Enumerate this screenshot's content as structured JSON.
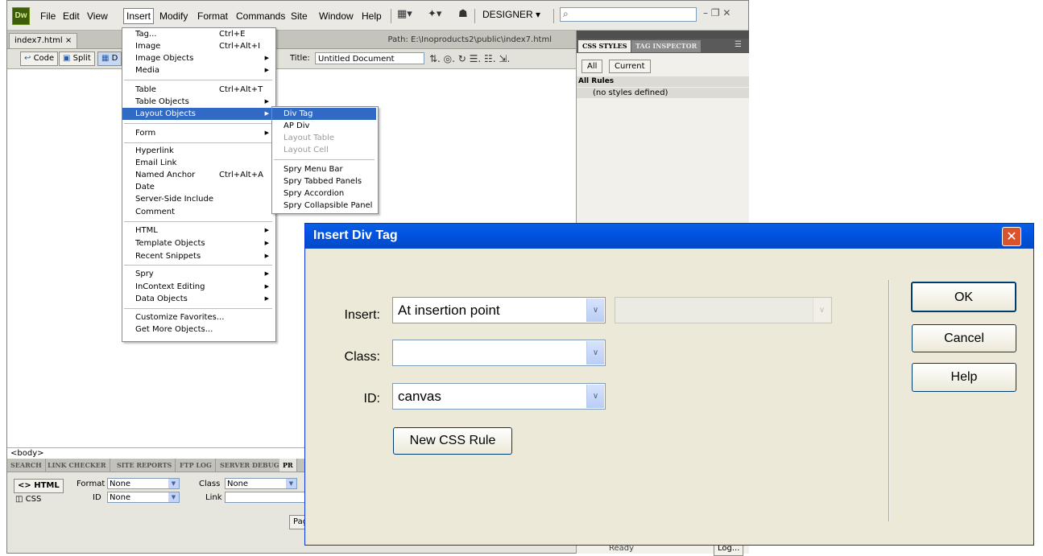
{
  "menubar": {
    "logo": "Dw",
    "items": [
      "File",
      "Edit",
      "View",
      "Insert",
      "Modify",
      "Format",
      "Commands",
      "Site",
      "Window",
      "Help"
    ],
    "workspace": "DESIGNER ▾",
    "layout_glyph": "▦▾",
    "extend_glyph": "✦▾",
    "site_glyph": "☗",
    "search_icon": "⌕",
    "window_controls": "–  ❐  ✕"
  },
  "document": {
    "tab_label": "index7.html  ×",
    "path": "Path:  E:\\Inoproducts2\\public\\index7.html",
    "toolbar": {
      "code": "Code",
      "split": "Split",
      "design_partial": "D",
      "title_label": "Title:",
      "title_value": "Untitled Document",
      "glyphs": "⇅.  ◎.    ↻  ☰.  ☷.     ⇲."
    },
    "tag_selector": "<body>"
  },
  "panels": {
    "tabs": [
      "SEARCH",
      "LINK CHECKER",
      "SITE REPORTS",
      "FTP LOG",
      "SERVER DEBUG",
      "PR"
    ],
    "html_button": "<> HTML",
    "css_button": "CSS",
    "format_label": "Format",
    "format_value": "None",
    "class_label": "Class",
    "class_value": "None",
    "id_label": "ID",
    "id_value": "None",
    "link_label": "Link",
    "page_btn_partial": "Pag"
  },
  "css_panel": {
    "tab1": "CSS STYLES",
    "tab2": "TAG INSPECTOR",
    "btn_all": "All",
    "btn_current": "Current",
    "all_rules": "All Rules",
    "no_styles": "(no styles defined)",
    "ready_partial": "Ready",
    "log_partial": "Log..."
  },
  "insert_menu": {
    "items": [
      {
        "label": "Tag...",
        "shortcut": "Ctrl+E"
      },
      {
        "label": "Image",
        "shortcut": "Ctrl+Alt+I"
      },
      {
        "label": "Image Objects",
        "submenu": true
      },
      {
        "label": "Media",
        "submenu": true
      },
      {
        "label": "Table",
        "shortcut": "Ctrl+Alt+T"
      },
      {
        "label": "Table Objects",
        "submenu": true
      },
      {
        "label": "Layout Objects",
        "submenu": true,
        "highlighted": true
      },
      {
        "label": "Form",
        "submenu": true
      },
      {
        "label": "Hyperlink"
      },
      {
        "label": "Email Link"
      },
      {
        "label": "Named Anchor",
        "shortcut": "Ctrl+Alt+A"
      },
      {
        "label": "Date"
      },
      {
        "label": "Server-Side Include"
      },
      {
        "label": "Comment"
      },
      {
        "label": "HTML",
        "submenu": true
      },
      {
        "label": "Template Objects",
        "submenu": true
      },
      {
        "label": "Recent Snippets",
        "submenu": true
      },
      {
        "label": "Spry",
        "submenu": true
      },
      {
        "label": "InContext Editing",
        "submenu": true
      },
      {
        "label": "Data Objects",
        "submenu": true
      },
      {
        "label": "Customize Favorites..."
      },
      {
        "label": "Get More Objects..."
      }
    ],
    "submenu_arrow": "▶"
  },
  "layout_submenu": {
    "items": [
      {
        "label": "Div Tag",
        "highlighted": true
      },
      {
        "label": "AP Div"
      },
      {
        "label": "Layout Table",
        "disabled": true
      },
      {
        "label": "Layout Cell",
        "disabled": true
      },
      {
        "label": "Spry Menu Bar"
      },
      {
        "label": "Spry Tabbed Panels"
      },
      {
        "label": "Spry Accordion"
      },
      {
        "label": "Spry Collapsible Panel"
      }
    ]
  },
  "dialog": {
    "title": "Insert Div Tag",
    "close": "✕",
    "insert_label": "Insert:",
    "insert_value": "At insertion point",
    "insert_secondary_value": "",
    "class_label": "Class:",
    "class_value": "",
    "id_label": "ID:",
    "id_value": "canvas",
    "new_css_rule": "New CSS Rule",
    "ok": "OK",
    "cancel": "Cancel",
    "help": "Help",
    "dropdown_arrow": "∨"
  }
}
